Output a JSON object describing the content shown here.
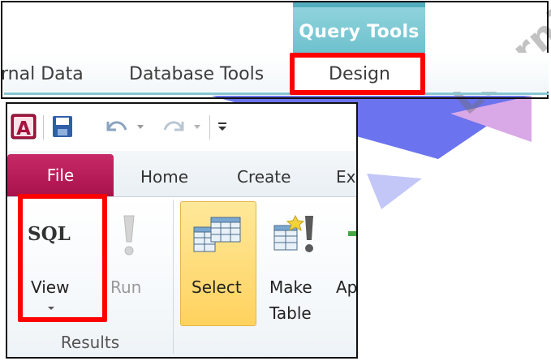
{
  "contextual_tab": {
    "label": "Query Tools"
  },
  "top_tabs": {
    "external": "rnal Data",
    "database_tools": "Database Tools",
    "design": "Design"
  },
  "file_tab": "File",
  "tabs": {
    "home": "Home",
    "create": "Create",
    "external_cut": "Ex"
  },
  "results_group": {
    "label": "Results",
    "sql_icon_text": "SQL",
    "view_label": "View",
    "run_label": "Run"
  },
  "query_type_group": {
    "select_label": "Select",
    "make_label": "Make",
    "table_label": "Table",
    "append_cut": "Ap"
  },
  "watermark": {
    "text": "Learni"
  },
  "icons": {
    "app": "access-logo-icon",
    "save": "save-icon",
    "undo": "undo-icon",
    "redo": "redo-icon",
    "customize": "customize-qat-icon",
    "run": "exclamation-icon",
    "select": "select-query-icon",
    "make_table": "make-table-icon",
    "view_dropdown": "dropdown-arrow-icon"
  },
  "colors": {
    "highlight": "#ff0000",
    "contextual_tab_bg": "#7ecbd6",
    "file_tab_bg": "#b71d58",
    "select_bg": "#ffd96e"
  }
}
